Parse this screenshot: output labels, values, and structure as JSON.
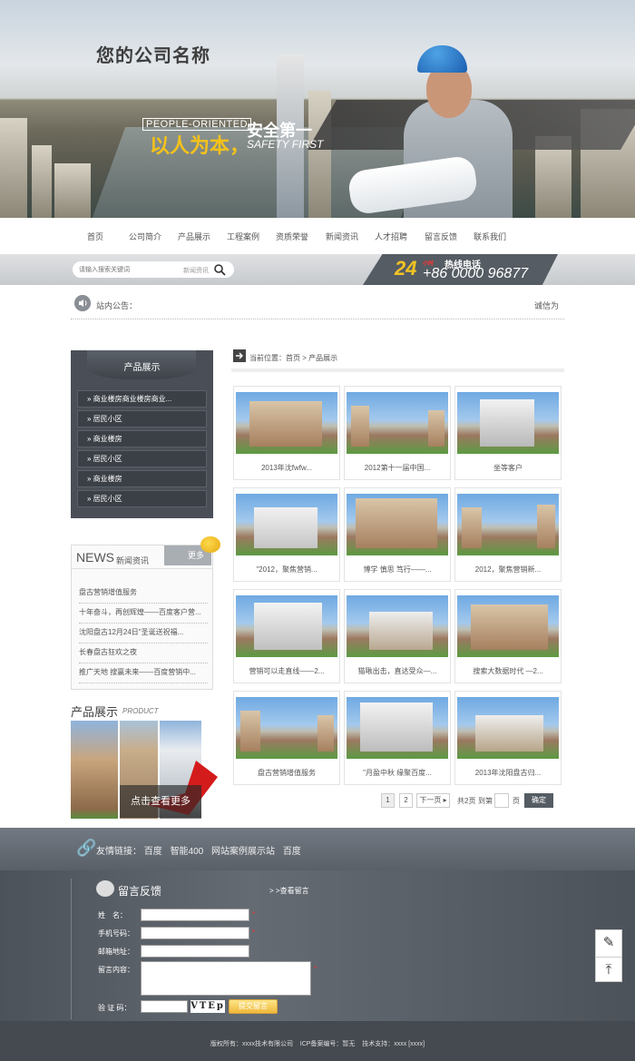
{
  "banner": {
    "company_name": "您的公司名称",
    "slogan_en": "PEOPLE-ORIENTED",
    "slogan_cn_1": "以人为本，",
    "slogan_cn_2": "安全第一",
    "slogan_sub": "SAFETY FIRST"
  },
  "nav": {
    "items": [
      "首页",
      "公司简介",
      "产品展示",
      "工程案例",
      "资质荣誉",
      "新闻资讯",
      "人才招聘",
      "留言反馈",
      "联系我们"
    ]
  },
  "search": {
    "placeholder": "请输入搜索关键词",
    "category": "新闻资讯"
  },
  "hotline": {
    "badge": "24",
    "tag": "小时",
    "label": "热线电话",
    "number": "+86 0000 96877"
  },
  "notice": {
    "label": "站内公告：",
    "text": "诚信为"
  },
  "side_products": {
    "title": "产品展示",
    "items": [
      "商业楼房商业楼房商业...",
      "居民小区",
      "商业楼房",
      "居民小区",
      "商业楼房",
      "居民小区"
    ]
  },
  "news": {
    "title_en": "NEWS",
    "title_cn": "新闻资讯",
    "more": "更多",
    "items": [
      "盘古营销增值服务",
      "十年奋斗，再创辉煌——百度客户营...",
      "沈阳盘古12月24日\"圣诞送祝福...",
      "长春盘古狂欢之夜",
      "推广天地 搜赢未来——百度营销中..."
    ]
  },
  "side_gallery": {
    "title": "产品展示",
    "subtitle": "PRODUCT",
    "cta": "点击查看更多"
  },
  "crumb": {
    "text": "当前位置：首页 > 产品展示"
  },
  "products": [
    {
      "caption": "2013年沈fwfw..."
    },
    {
      "caption": "2012第十一届中国..."
    },
    {
      "caption": "坐等客户"
    },
    {
      "caption": "\"2012，聚焦营销..."
    },
    {
      "caption": "博学 慎思 笃行——..."
    },
    {
      "caption": "2012，聚焦营销新..."
    },
    {
      "caption": "营销可以走直线——2..."
    },
    {
      "caption": "猫啾出击，直达受众—..."
    },
    {
      "caption": "搜索大数据时代 —2..."
    },
    {
      "caption": "盘古营销增值服务"
    },
    {
      "caption": "\"月盈中秋 缘聚百度..."
    },
    {
      "caption": "2013年沈阳盘古归..."
    }
  ],
  "pager": {
    "page1": "1",
    "page2": "2",
    "next": "下一页",
    "total": "共2页",
    "goto": "到第",
    "page_unit": "页",
    "go": "确定"
  },
  "links": {
    "label": "友情链接：",
    "items": [
      "百度",
      "智能400",
      "网站案例展示站",
      "百度"
    ]
  },
  "feedback": {
    "title": "留言反馈",
    "view": "> >查看留言",
    "name_label": "姓　名：",
    "phone_label": "手机号码：",
    "email_label": "邮箱地址：",
    "content_label": "留言内容：",
    "code_label": "验 证 码：",
    "captcha": "VTEp",
    "submit": "提交留言",
    "required": "*"
  },
  "copyright": {
    "text": "版权所有：xxxx技术有限公司    ICP备案编号：暂无    技术支持：xxxx [xxxx]"
  }
}
